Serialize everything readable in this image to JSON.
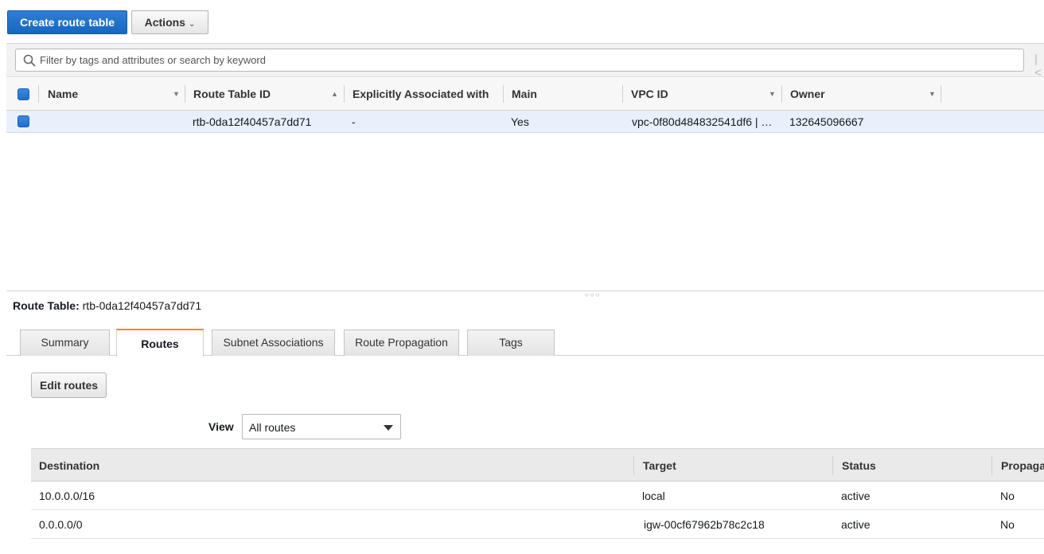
{
  "toolbar": {
    "create_label": "Create route table",
    "actions_label": "Actions"
  },
  "filter": {
    "placeholder": "Filter by tags and attributes or search by keyword"
  },
  "grid": {
    "columns": [
      "Name",
      "Route Table ID",
      "Explicitly Associated with",
      "Main",
      "VPC ID",
      "Owner"
    ],
    "rows": [
      {
        "name": "",
        "route_table_id": "rtb-0da12f40457a7dd71",
        "explicitly_associated": "-",
        "main": "Yes",
        "vpc_id": "vpc-0f80d484832541df6 | …",
        "owner": "132645096667"
      }
    ]
  },
  "detail": {
    "title_label": "Route Table:",
    "title_value": "rtb-0da12f40457a7dd71",
    "tabs": [
      "Summary",
      "Routes",
      "Subnet Associations",
      "Route Propagation",
      "Tags"
    ],
    "active_tab": "Routes",
    "edit_routes_label": "Edit routes",
    "view_label": "View",
    "view_selected": "All routes"
  },
  "routes": {
    "columns": [
      "Destination",
      "Target",
      "Status",
      "Propaga"
    ],
    "rows": [
      {
        "destination": "10.0.0.0/16",
        "target": "local",
        "status": "active",
        "propagated": "No"
      },
      {
        "destination": "0.0.0.0/0",
        "target": "igw-00cf67962b78c2c18",
        "status": "active",
        "propagated": "No"
      }
    ]
  },
  "colors": {
    "primary": "#1766c0",
    "link": "#1f5eb3",
    "active_status": "#1d8102",
    "tab_accent": "#ec8b17",
    "selected_row": "#e8f0fb"
  },
  "icons": {
    "search": "search-icon",
    "actions_chevron": "chevron-down-icon",
    "sort_asc": "sort-ascending-icon",
    "sort_desc": "sort-descending-icon",
    "pager_first": "first-page-icon",
    "splitter": "drag-handle-icon",
    "select_caret": "caret-down-icon"
  }
}
